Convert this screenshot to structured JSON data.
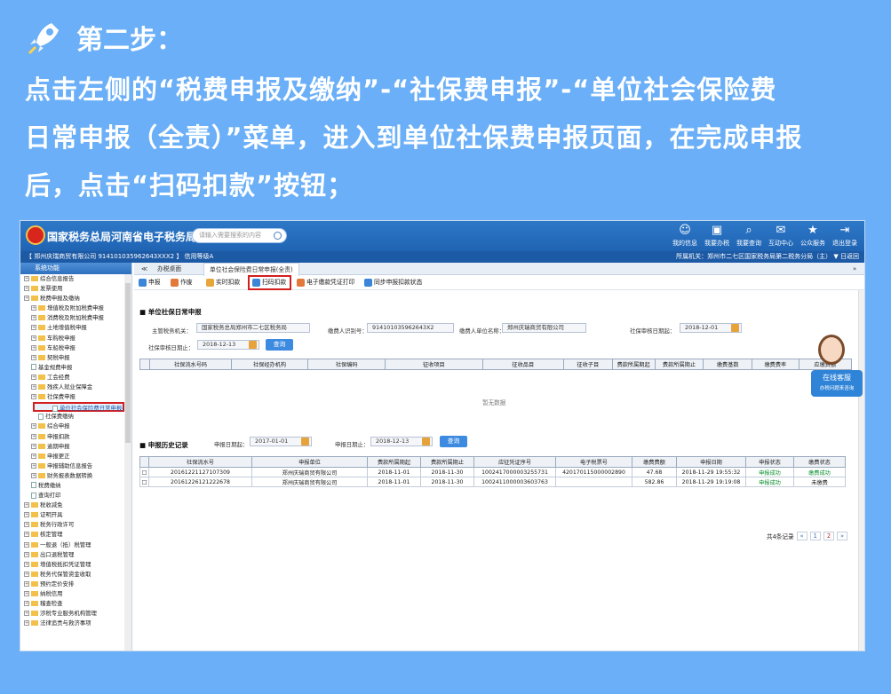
{
  "step": {
    "title": "第二步：",
    "lines": [
      "点击左侧的“税费申报及缴纳”-“社保费申报”-“单位社会保险费",
      "日常申报（全责）”菜单，进入到单位社保费申报页面，在完成申报",
      "后，点击“扫码扣款”按钮；"
    ]
  },
  "app": {
    "title": "国家税务总局河南省电子税务局",
    "search_placeholder": "请输入需要搜索的内容",
    "topnav": [
      {
        "icon": "user-icon",
        "glyph": "☺",
        "label": "我的信息"
      },
      {
        "icon": "monitor-icon",
        "glyph": "▣",
        "label": "我要办税"
      },
      {
        "icon": "query-icon",
        "glyph": "⌕",
        "label": "我要查询"
      },
      {
        "icon": "chat-icon",
        "glyph": "✉",
        "label": "互动中心"
      },
      {
        "icon": "service-icon",
        "glyph": "★",
        "label": "公众服务"
      },
      {
        "icon": "logout-icon",
        "glyph": "⇥",
        "label": "退出登录"
      }
    ],
    "strip_left": "【 郑州庆瑞商贸有限公司    914101035962643XXX2 】  信用等级A",
    "strip_right": "所属机关：郑州市二七区国家税务局第二税务分局（主）   ▼   日返回"
  },
  "sidebar": {
    "header": "系统功能",
    "items": [
      {
        "label": "综合信息报告",
        "t": "f",
        "d": 0
      },
      {
        "label": "发票使用",
        "t": "f",
        "d": 0
      },
      {
        "label": "税费申报及缴纳",
        "t": "f",
        "d": 0
      },
      {
        "label": "增值税及附加税费申报",
        "t": "f",
        "d": 1
      },
      {
        "label": "消费税及附加税费申报",
        "t": "f",
        "d": 1
      },
      {
        "label": "土地增值税申报",
        "t": "f",
        "d": 1
      },
      {
        "label": "车购税申报",
        "t": "f",
        "d": 1
      },
      {
        "label": "车船税申报",
        "t": "f",
        "d": 1
      },
      {
        "label": "契税申报",
        "t": "f",
        "d": 1
      },
      {
        "label": "基金规费申报",
        "t": "p",
        "d": 1
      },
      {
        "label": "工会经费",
        "t": "f",
        "d": 1
      },
      {
        "label": "残疾人就业保障金",
        "t": "f",
        "d": 1
      },
      {
        "label": "社保费申报",
        "t": "f",
        "d": 1
      },
      {
        "label": "单位社会保险费日常申报(",
        "t": "p",
        "d": 2,
        "sel": true
      },
      {
        "label": "社保费缴纳",
        "t": "p",
        "d": 2
      },
      {
        "label": "综合申报",
        "t": "f",
        "d": 1
      },
      {
        "label": "申报扣款",
        "t": "f",
        "d": 1
      },
      {
        "label": "逾期申报",
        "t": "f",
        "d": 1
      },
      {
        "label": "申报更正",
        "t": "f",
        "d": 1
      },
      {
        "label": "申报辅助信息报告",
        "t": "f",
        "d": 1
      },
      {
        "label": "财务报表数据转换",
        "t": "f",
        "d": 1
      },
      {
        "label": "税费缴纳",
        "t": "p",
        "d": 1
      },
      {
        "label": "查询打印",
        "t": "p",
        "d": 1
      },
      {
        "label": "税收减免",
        "t": "f",
        "d": 0
      },
      {
        "label": "证明开具",
        "t": "f",
        "d": 0
      },
      {
        "label": "税务行政许可",
        "t": "f",
        "d": 0
      },
      {
        "label": "核定管理",
        "t": "f",
        "d": 0
      },
      {
        "label": "一般退（抵）税管理",
        "t": "f",
        "d": 0
      },
      {
        "label": "出口退税管理",
        "t": "f",
        "d": 0
      },
      {
        "label": "增值税抵扣凭证管理",
        "t": "f",
        "d": 0
      },
      {
        "label": "税务代保管资金收取",
        "t": "f",
        "d": 0
      },
      {
        "label": "预约定价安排",
        "t": "f",
        "d": 0
      },
      {
        "label": "纳税信用",
        "t": "f",
        "d": 0
      },
      {
        "label": "稽查检查",
        "t": "f",
        "d": 0
      },
      {
        "label": "涉税专业服务机构管理",
        "t": "f",
        "d": 0
      },
      {
        "label": "法律追责与救济事项",
        "t": "f",
        "d": 0
      }
    ]
  },
  "tabs": {
    "nav": "≪",
    "home": "办税桌面",
    "current": "单位社会保险费日常申报(全责)",
    "next": "»"
  },
  "toolbar": {
    "buttons": [
      {
        "label": "申报",
        "color": "#3b86d8"
      },
      {
        "label": "作废",
        "color": "#e2793a"
      },
      {
        "label": "实时扣款",
        "color": "#e8a63a"
      },
      {
        "label": "扫码扣款",
        "color": "#3b86d8"
      },
      {
        "label": "电子缴款凭证打印",
        "color": "#e2793a"
      },
      {
        "label": "同步申报扣款状态",
        "color": "#3b86d8"
      }
    ]
  },
  "daily": {
    "title": "单位社保日常申报",
    "tax_office_label": "主管税务机关：",
    "tax_office": "国家税务总局郑州市二七区税务局",
    "taxpayer_id_label": "缴费人识别号：",
    "taxpayer_id": "914101035962643X2",
    "unit_name_label": "缴费人单位名称：",
    "unit_name": "郑州庆瑞商贸有限公司",
    "period_start_label": "社保审核日期起：",
    "period_start": "2018-12-01",
    "period_end_label": "社保审核日期止：",
    "period_end": "2018-12-13",
    "query": "查询",
    "columns": [
      "社保流水号码",
      "社保经办机构",
      "社保编码",
      "征收项目",
      "征收品目",
      "征收子目",
      "费款所属期起",
      "费款所属期止",
      "缴费基数",
      "缴费费率",
      "应缴费额"
    ],
    "empty": "暂无数据"
  },
  "history": {
    "title": "申报历史记录",
    "start_label": "申报日期起：",
    "start": "2017-01-01",
    "end_label": "申报日期止：",
    "end": "2018-12-13",
    "query": "查询",
    "columns": [
      "社保流水号",
      "申报单位",
      "费款所属期起",
      "费款所属期止",
      "应征凭证序号",
      "电子税票号",
      "缴费费额",
      "申报日期",
      "申报状态",
      "缴费状态"
    ],
    "rows": [
      [
        "20161221127107309",
        "郑州庆瑞商贸有限公司",
        "2018-11-01",
        "2018-11-30",
        "1002417000003255731",
        "420170115000002890",
        "47.68",
        "2018-11-29 19:55:32",
        "申报成功",
        "缴费成功"
      ],
      [
        "20161226121222678",
        "郑州庆瑞商贸有限公司",
        "2018-11-01",
        "2018-11-30",
        "1002411000003603763",
        "",
        "582.86",
        "2018-11-29 19:19:08",
        "申报成功",
        "未缴费"
      ]
    ],
    "pager": {
      "total": "共4条记录",
      "prev": "«",
      "p1": "1",
      "p2": "2",
      "next": "»"
    }
  },
  "cs": {
    "title": "在线客服",
    "sub": "办税问题来咨询"
  }
}
